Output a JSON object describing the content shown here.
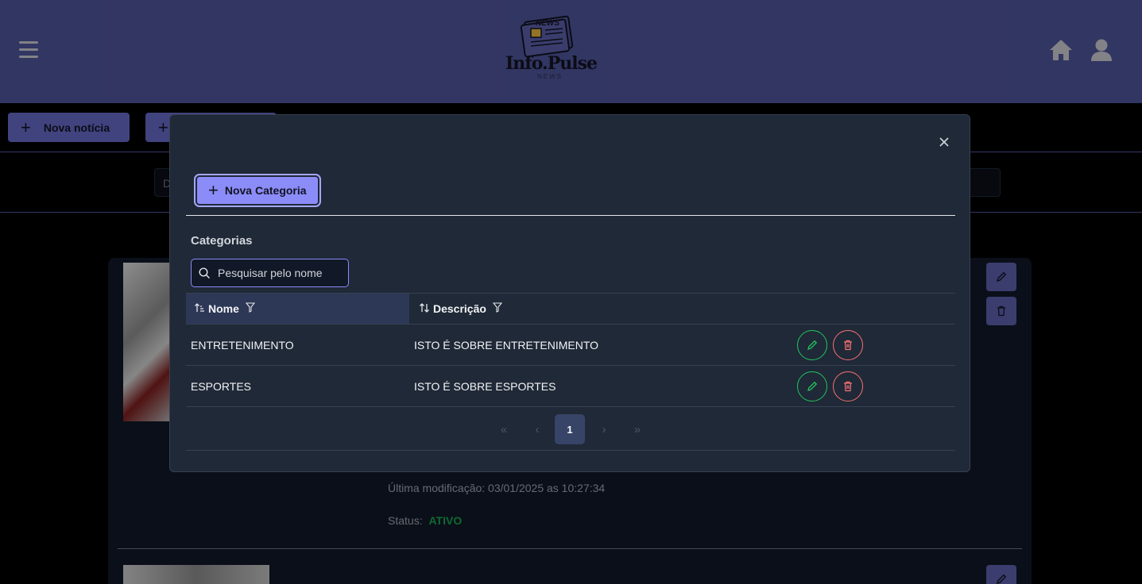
{
  "header": {
    "logo_title": "Info.Pulse",
    "logo_subtitle": "NEWS",
    "logo_badge": "NEWS",
    "menu_icon": "hamburger-icon",
    "home_icon": "home-icon",
    "user_icon": "user-icon",
    "brand_color": "#4e5397"
  },
  "toolbar": {
    "nova_noticia_label": "Nova notícia",
    "second_button_prefix": "+"
  },
  "background": {
    "filter_input_visible_char": "D",
    "card_last_modified": "Última modificação: 03/01/2025 as 10:27:34",
    "card_status_label": "Status:",
    "card_status_value": "ATIVO",
    "status_color": "#16a34a"
  },
  "modal": {
    "nova_categoria_label": "Nova Categoria",
    "section_title": "Categorias",
    "search": {
      "placeholder": "Pesquisar pelo nome",
      "value": ""
    },
    "columns": [
      {
        "label": "Nome",
        "sorted": "asc"
      },
      {
        "label": "Descrição",
        "sorted": "none"
      }
    ],
    "rows": [
      {
        "nome": "ENTRETENIMENTO",
        "descricao": "ISTO É SOBRE ENTRETENIMENTO"
      },
      {
        "nome": "ESPORTES",
        "descricao": "ISTO É SOBRE ESPORTES"
      }
    ],
    "pagination": {
      "current_page": "1"
    },
    "accent_color": "#8b8cf8",
    "edit_color": "#22c55e",
    "delete_color": "#f87171"
  }
}
